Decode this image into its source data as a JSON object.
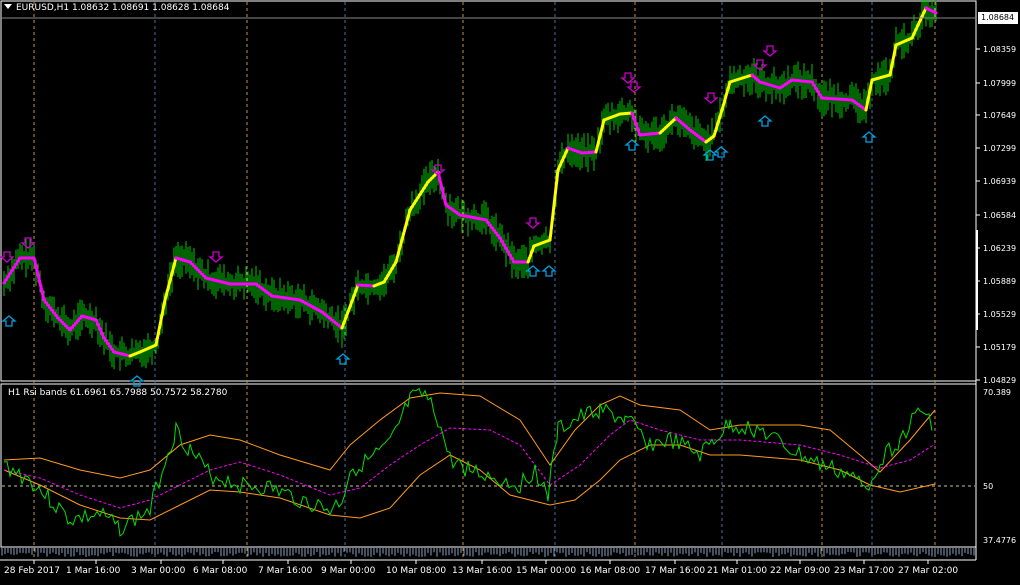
{
  "main_chart": {
    "symbol_header": "EURUSD,H1  1.08632 1.08691 1.08628 1.08684",
    "current_price": "1.08684",
    "price_ticks": [
      "1.08359",
      "1.07999",
      "1.07649",
      "1.07299",
      "1.06939",
      "1.06584",
      "1.06239",
      "1.05889",
      "1.05529",
      "1.05179",
      "1.04829"
    ],
    "colors": {
      "up_trend": "#ffff00",
      "down_trend": "#ff00ff",
      "bars": "#00c800",
      "sell_arrow": "#c800c8",
      "buy_arrow": "#00a0e0",
      "grid": "#4a6fa0",
      "grid_alt": "#c89040"
    }
  },
  "rsi_panel": {
    "title": "H1 Rsi bands 61.6961 65.7988 50.7572 58.2780",
    "ticks": [
      "70.389",
      "50",
      "37.4776"
    ],
    "colors": {
      "rsi": "#00e000",
      "upper": "#ff9a20",
      "lower": "#ff9a20",
      "mid": "#ff00ff",
      "level": "#808080"
    }
  },
  "time_axis": {
    "labels": [
      "28 Feb 2017",
      "1 Mar 16:00",
      "3 Mar 00:00",
      "6 Mar 08:00",
      "7 Mar 16:00",
      "9 Mar 00:00",
      "10 Mar 08:00",
      "13 Mar 16:00",
      "15 Mar 00:00",
      "16 Mar 08:00",
      "17 Mar 16:00",
      "21 Mar 01:00",
      "22 Mar 09:00",
      "23 Mar 17:00",
      "27 Mar 02:00"
    ]
  },
  "chart_data": {
    "type": "line",
    "title": "EURUSD,H1",
    "x": [
      "28 Feb 2017",
      "1 Mar 16:00",
      "3 Mar 00:00",
      "6 Mar 08:00",
      "7 Mar 16:00",
      "9 Mar 00:00",
      "10 Mar 08:00",
      "13 Mar 16:00",
      "15 Mar 00:00",
      "16 Mar 08:00",
      "17 Mar 16:00",
      "21 Mar 01:00",
      "22 Mar 09:00",
      "23 Mar 17:00",
      "27 Mar 02:00"
    ],
    "series": [
      {
        "values": [
          1.0589,
          1.054,
          1.051,
          1.06,
          1.0578,
          1.0535,
          1.0685,
          1.0655,
          1.0605,
          1.073,
          1.0748,
          1.074,
          1.08,
          1.079,
          1.087
        ]
      }
    ],
    "ylim": [
      1.04829,
      1.08684
    ]
  }
}
